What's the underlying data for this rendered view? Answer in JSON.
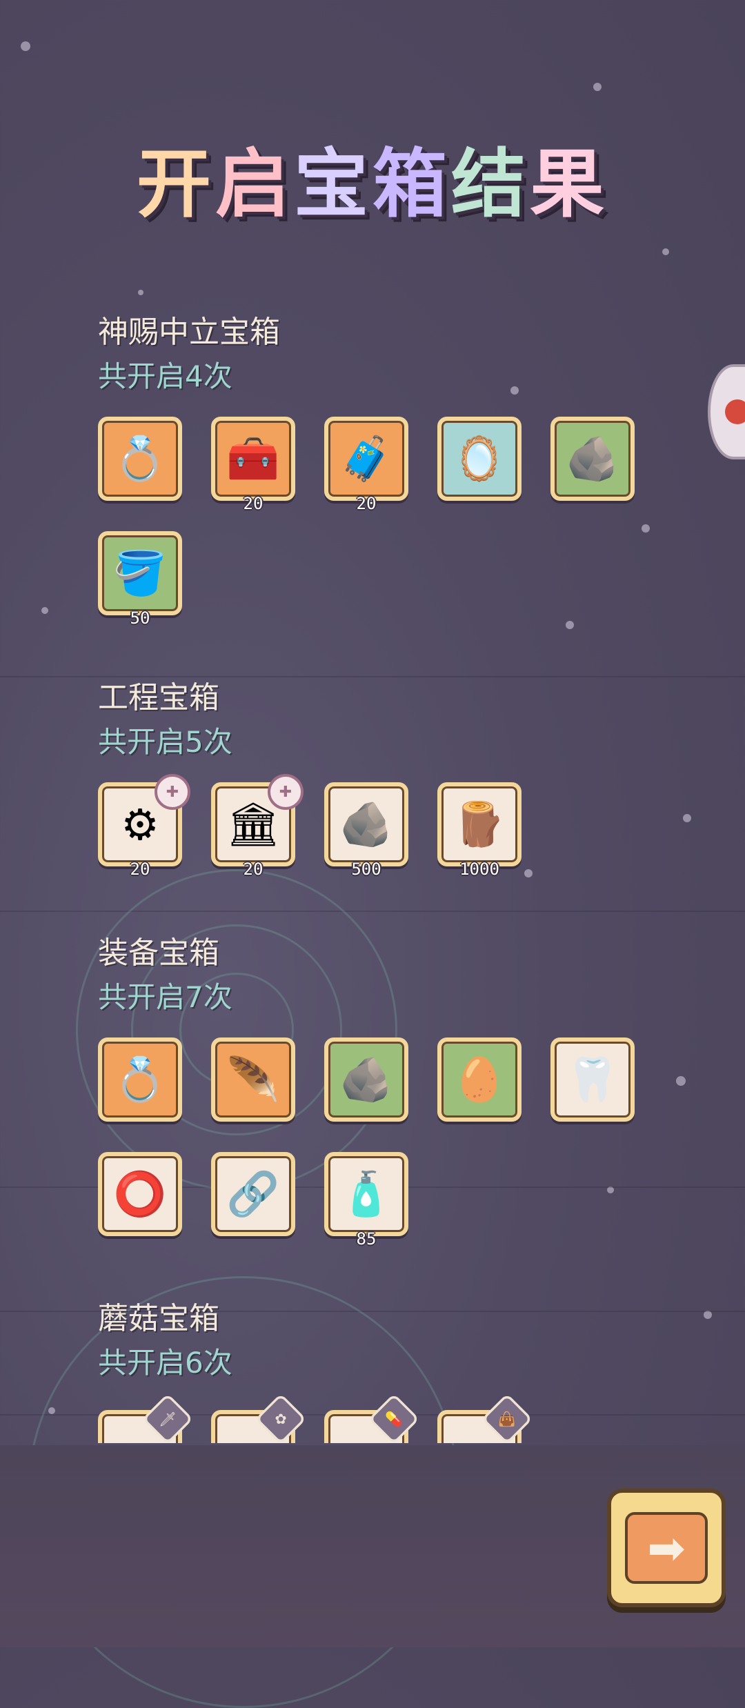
{
  "title_chars": [
    "开",
    "启",
    "宝",
    "箱",
    "结",
    "果"
  ],
  "sections": [
    {
      "name": "神赐中立宝箱",
      "count": "共开启4次",
      "items": [
        {
          "icon": "💍",
          "bg": "orange",
          "qty": ""
        },
        {
          "icon": "🧰",
          "bg": "orange",
          "qty": "20"
        },
        {
          "icon": "🧳",
          "bg": "orange",
          "qty": "20"
        },
        {
          "icon": "🪞",
          "bg": "blue",
          "qty": ""
        },
        {
          "icon": "🪨",
          "bg": "green",
          "qty": ""
        },
        {
          "icon": "🪣",
          "bg": "green",
          "qty": "50"
        }
      ]
    },
    {
      "name": "工程宝箱",
      "count": "共开启5次",
      "items": [
        {
          "icon": "⚙",
          "bg": "cream",
          "qty": "20",
          "badge": "✚"
        },
        {
          "icon": "🏛",
          "bg": "cream",
          "qty": "20",
          "badge": "✚"
        },
        {
          "icon": "🪨",
          "bg": "cream",
          "qty": "500"
        },
        {
          "icon": "🪵",
          "bg": "cream",
          "qty": "1000"
        }
      ]
    },
    {
      "name": "装备宝箱",
      "count": "共开启7次",
      "items": [
        {
          "icon": "💍",
          "bg": "orange",
          "qty": ""
        },
        {
          "icon": "🪶",
          "bg": "orange",
          "qty": ""
        },
        {
          "icon": "🪨",
          "bg": "green",
          "qty": ""
        },
        {
          "icon": "🥚",
          "bg": "green",
          "qty": ""
        },
        {
          "icon": "🦷",
          "bg": "cream",
          "qty": ""
        },
        {
          "icon": "⭕",
          "bg": "cream",
          "qty": ""
        },
        {
          "icon": "🔗",
          "bg": "cream",
          "qty": ""
        },
        {
          "icon": "🧴",
          "bg": "cream",
          "qty": "85"
        }
      ]
    },
    {
      "name": "蘑菇宝箱",
      "count": "共开启6次",
      "items": [
        {
          "icon": "",
          "bg": "cream",
          "qty": "",
          "hex": "🗡"
        },
        {
          "icon": "",
          "bg": "cream",
          "qty": "",
          "hex": "✿"
        },
        {
          "icon": "",
          "bg": "cream",
          "qty": "",
          "hex": "💊"
        },
        {
          "icon": "",
          "bg": "cream",
          "qty": "",
          "hex": "👜"
        }
      ]
    }
  ],
  "next_button": {
    "icon": "➡"
  }
}
